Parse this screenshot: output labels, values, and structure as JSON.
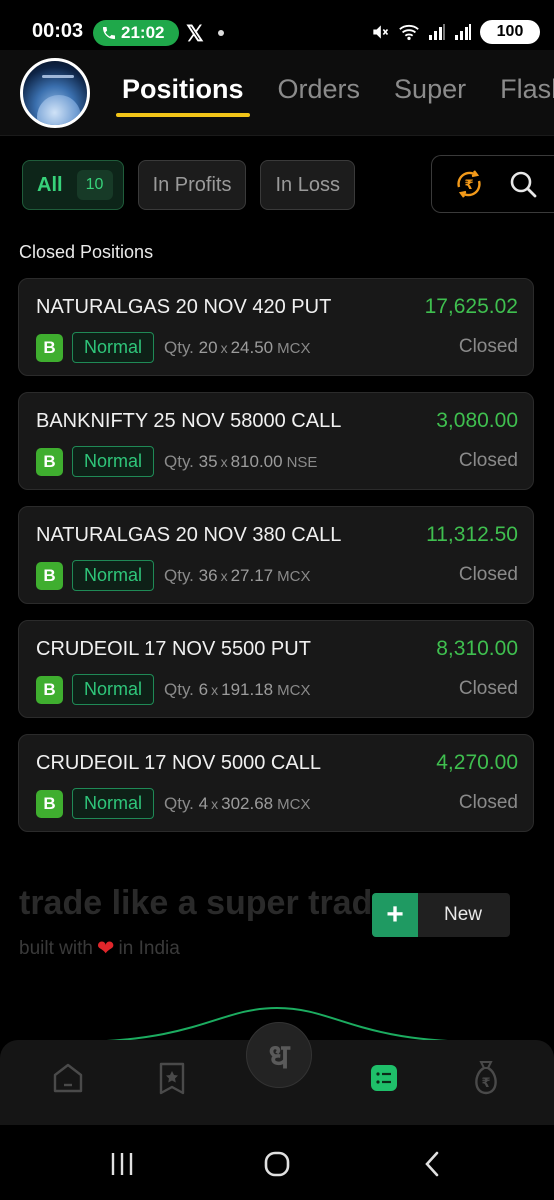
{
  "status_bar": {
    "time": "00:03",
    "call_time": "21:02",
    "battery": "100",
    "app_icon": "x-logo"
  },
  "header": {
    "tabs": [
      {
        "label": "Positions",
        "active": true
      },
      {
        "label": "Orders",
        "active": false
      },
      {
        "label": "Super",
        "active": false
      },
      {
        "label": "Flash",
        "active": false
      }
    ],
    "accent_color": "#f2c418"
  },
  "filters": {
    "all_label": "All",
    "all_count": "10",
    "profits_label": "In Profits",
    "loss_label": "In Loss",
    "icons": [
      "rupee-refresh-icon",
      "search-icon"
    ]
  },
  "section_title": "Closed Positions",
  "positions": [
    {
      "symbol": "NATURALGAS 20 NOV 420 PUT",
      "pnl": "17,625.02",
      "side": "B",
      "order_type": "Normal",
      "qty_label": "Qty.",
      "qty": "20",
      "price": "24.50",
      "exchange": "MCX",
      "status": "Closed"
    },
    {
      "symbol": "BANKNIFTY 25 NOV 58000 CALL",
      "pnl": "3,080.00",
      "side": "B",
      "order_type": "Normal",
      "qty_label": "Qty.",
      "qty": "35",
      "price": "810.00",
      "exchange": "NSE",
      "status": "Closed"
    },
    {
      "symbol": "NATURALGAS 20 NOV 380 CALL",
      "pnl": "11,312.50",
      "side": "B",
      "order_type": "Normal",
      "qty_label": "Qty.",
      "qty": "36",
      "price": "27.17",
      "exchange": "MCX",
      "status": "Closed"
    },
    {
      "symbol": "CRUDEOIL 17 NOV 5500 PUT",
      "pnl": "8,310.00",
      "side": "B",
      "order_type": "Normal",
      "qty_label": "Qty.",
      "qty": "6",
      "price": "191.18",
      "exchange": "MCX",
      "status": "Closed"
    },
    {
      "symbol": "CRUDEOIL 17 NOV 5000 CALL",
      "pnl": "4,270.00",
      "side": "B",
      "order_type": "Normal",
      "qty_label": "Qty.",
      "qty": "4",
      "price": "302.68",
      "exchange": "MCX",
      "status": "Closed"
    }
  ],
  "promo": {
    "tagline": "trade like a super trad",
    "built_prefix": "built with",
    "built_suffix": "in India"
  },
  "new_button": {
    "label": "New"
  },
  "bottom_nav": {
    "center_glyph": "ध",
    "items": [
      "home-icon",
      "watchlist-icon",
      "positions-icon",
      "funds-icon"
    ]
  },
  "colors": {
    "profit_green": "#3fbf4f",
    "badge_green": "#3fae2f",
    "normal_green": "#2fc67a"
  }
}
